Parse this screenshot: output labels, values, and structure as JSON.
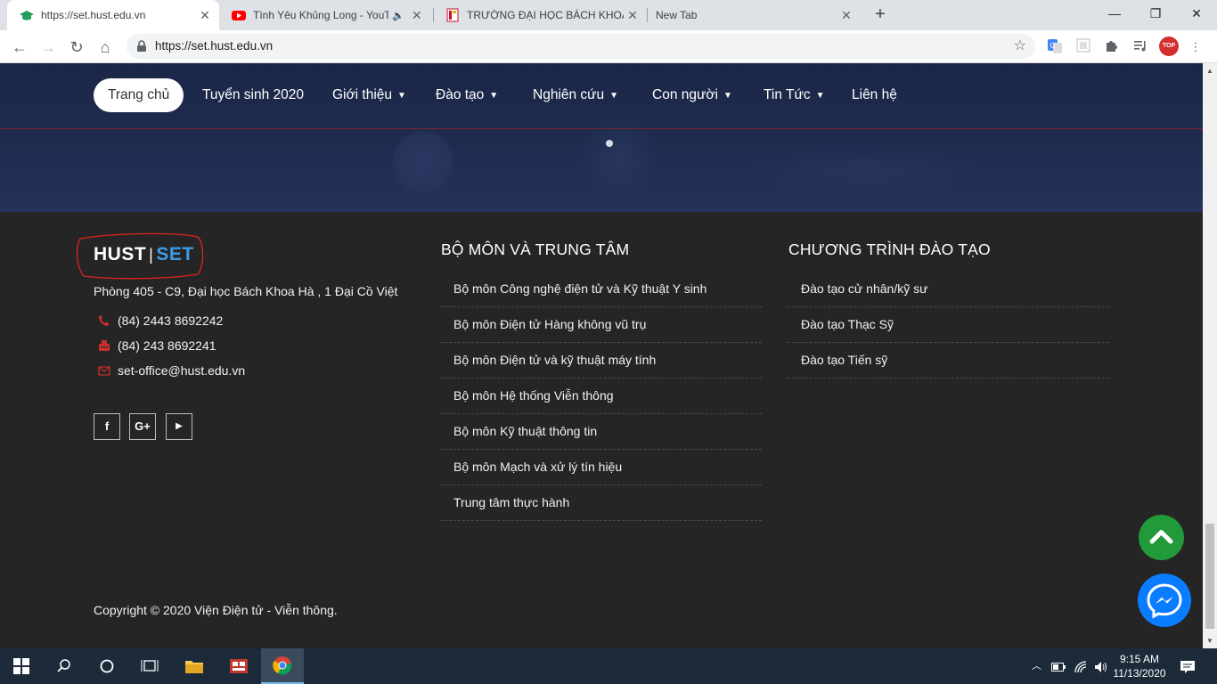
{
  "browser": {
    "tabs": [
      {
        "title": "https://set.hust.edu.vn",
        "icon": "graduation-cap-icon",
        "active": true
      },
      {
        "title": "Tình Yêu Khủng Long - YouTube",
        "icon": "youtube-icon",
        "audio": true
      },
      {
        "title": "TRƯỜNG ĐẠI HỌC BÁCH KHOA HÀ NỘI",
        "icon": "hust-logo-icon"
      },
      {
        "title": "New Tab",
        "icon": ""
      }
    ],
    "new_tab_label": "+",
    "url": "https://set.hust.edu.vn",
    "extensions": [
      "translate-icon",
      "extension-grid-icon",
      "puzzle-icon",
      "media-control-icon"
    ],
    "profile_badge": "TOP"
  },
  "nav": {
    "items": [
      {
        "label": "Trang chủ",
        "active": true,
        "dropdown": false
      },
      {
        "label": "Tuyển sinh 2020",
        "dropdown": false
      },
      {
        "label": "Giới thiệu",
        "dropdown": true
      },
      {
        "label": "Đào tạo",
        "dropdown": true
      },
      {
        "label": "Nghiên cứu",
        "dropdown": true
      },
      {
        "label": "Con người",
        "dropdown": true
      },
      {
        "label": "Tin Tức",
        "dropdown": true
      },
      {
        "label": "Liên hệ",
        "dropdown": false
      }
    ]
  },
  "footer": {
    "logo": {
      "part1": "HUST",
      "separator": "|",
      "part2": "SET"
    },
    "address": "Phòng 405 - C9, Đại học Bách Khoa Hà , 1 Đại Cồ Việt",
    "phone": "(84) 2443 8692242",
    "fax": "(84) 243 8692241",
    "email": "set-office@hust.edu.vn",
    "social": [
      {
        "icon": "facebook-icon",
        "glyph": "f"
      },
      {
        "icon": "google-plus-icon",
        "glyph": "G+"
      },
      {
        "icon": "youtube-icon",
        "glyph": "▶"
      }
    ],
    "departments": {
      "title": "BỘ MÔN VÀ TRUNG TÂM",
      "items": [
        "Bộ môn Công nghệ điện tử và Kỹ thuật Y sinh",
        "Bộ môn Điện tử Hàng không vũ trụ",
        "Bộ môn Điện tử và kỹ thuật máy tính",
        "Bộ môn Hệ thống Viễn thông",
        "Bộ môn Kỹ thuật thông tin",
        "Bộ môn Mạch và xử lý tín hiệu",
        "Trung tâm thực hành"
      ]
    },
    "programs": {
      "title": "CHƯƠNG TRÌNH ĐÀO TẠO",
      "items": [
        "Đào tạo cử nhân/kỹ sư",
        "Đào tạo Thạc Sỹ",
        "Đào tạo Tiến sỹ"
      ]
    },
    "copyright": "Copyright © 2020 Viện Điện tử - Viễn thông."
  },
  "colors": {
    "nav_bg": "#1f2c50",
    "footer_bg": "#252525",
    "logo_accent": "#3d9be8",
    "to_top": "#229a3a",
    "messenger": "#0a7cff",
    "icon_red": "#c9302c"
  },
  "taskbar": {
    "time": "9:15 AM",
    "date": "11/13/2020",
    "apps": [
      "windows-start-icon",
      "search-icon",
      "cortana-icon",
      "task-view-icon",
      "file-explorer-icon",
      "app-icon",
      "chrome-icon"
    ]
  }
}
